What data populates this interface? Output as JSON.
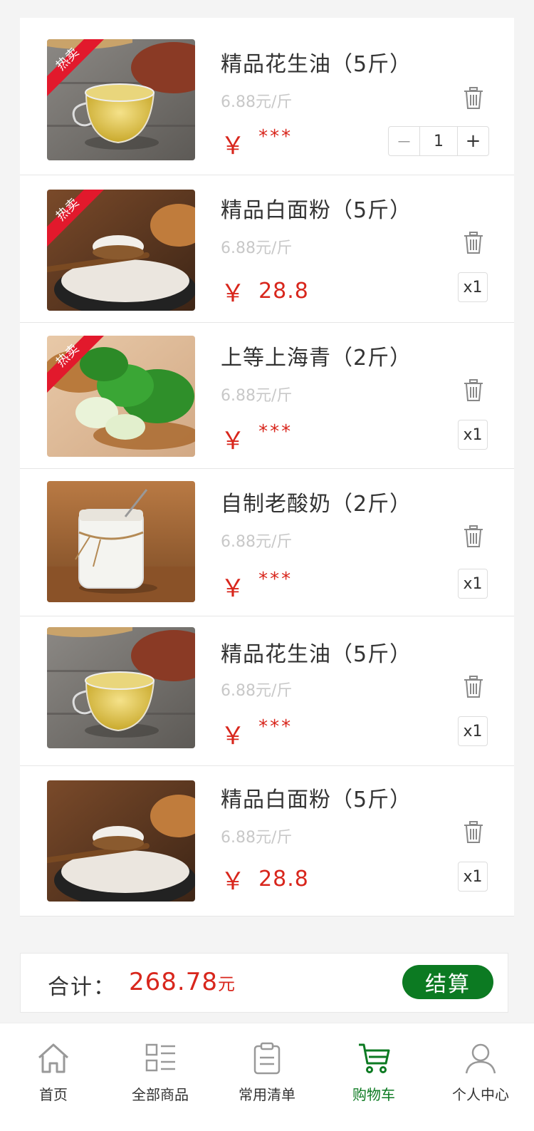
{
  "cart": {
    "items": [
      {
        "name": "精品花生油（5斤）",
        "unit_price": "6.88元/斤",
        "currency": "￥",
        "price": "***",
        "hot_label": "热卖",
        "image": "peanut-oil-image",
        "qty": "1",
        "minus": "－",
        "plus": "+"
      },
      {
        "name": "精品白面粉（5斤）",
        "unit_price": "6.88元/斤",
        "currency": "￥",
        "price": "28.8",
        "hot_label": "热卖",
        "image": "flour-image",
        "qty": "x1"
      },
      {
        "name": "上等上海青（2斤）",
        "unit_price": "6.88元/斤",
        "currency": "￥",
        "price": "***",
        "hot_label": "热卖",
        "image": "bok-choy-image",
        "qty": "x1"
      },
      {
        "name": "自制老酸奶（2斤）",
        "unit_price": "6.88元/斤",
        "currency": "￥",
        "price": "***",
        "image": "yogurt-image",
        "qty": "x1"
      },
      {
        "name": "精品花生油（5斤）",
        "unit_price": "6.88元/斤",
        "currency": "￥",
        "price": "***",
        "image": "peanut-oil-image",
        "qty": "x1"
      },
      {
        "name": "精品白面粉（5斤）",
        "unit_price": "6.88元/斤",
        "currency": "￥",
        "price": "28.8",
        "image": "flour-image",
        "qty": "x1"
      }
    ]
  },
  "summary": {
    "label": "合计：",
    "amount": "268.78",
    "unit": "元",
    "checkout": "结算"
  },
  "tabbar": {
    "tabs": [
      {
        "label": "首页",
        "icon": "home-icon"
      },
      {
        "label": "全部商品",
        "icon": "grid-list-icon"
      },
      {
        "label": "常用清单",
        "icon": "clipboard-icon"
      },
      {
        "label": "购物车",
        "icon": "cart-icon",
        "active": true
      },
      {
        "label": "个人中心",
        "icon": "user-icon"
      }
    ]
  },
  "colors": {
    "accent_green": "#0c7a22",
    "price_red": "#d8261c",
    "hot_badge": "#e2192c"
  }
}
